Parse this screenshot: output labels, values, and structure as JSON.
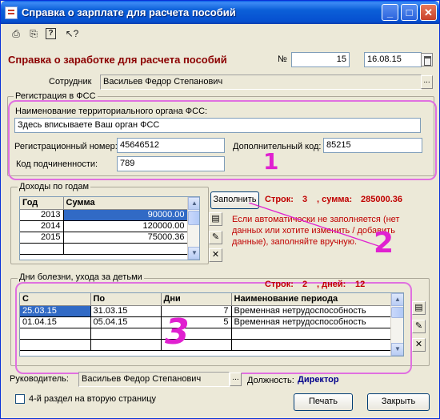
{
  "window": {
    "title": "Справка о зарплате для расчета пособий"
  },
  "toolbar": {
    "icons": [
      "print-preview-icon",
      "print-icon",
      "help-icon",
      "whats-this-icon"
    ]
  },
  "form": {
    "header": "Справка о заработке для расчета пособий",
    "number_label": "№",
    "number": "15",
    "date": "16.08.15",
    "employee_label": "Сотрудник",
    "employee": "Васильев Федор Степанович"
  },
  "fss": {
    "group_title": "Регистрация в ФСС",
    "org_label": "Наименование территориального органа ФСС:",
    "org_value": "Здесь вписываете Ваш орган ФСС",
    "reg_label": "Регистрационный номер:",
    "reg_value": "45646512",
    "add_label": "Дополнительный код:",
    "add_value": "85215",
    "sub_label": "Код подчиненности:",
    "sub_value": "789",
    "annotation": "1"
  },
  "income": {
    "group_title": "Доходы по годам",
    "columns": [
      "Год",
      "Сумма"
    ],
    "rows": [
      {
        "year": "2013",
        "sum": "90000.00"
      },
      {
        "year": "2014",
        "sum": "120000.00"
      },
      {
        "year": "2015",
        "sum": "75000.36"
      }
    ],
    "fill_button": "Заполнить",
    "rows_label": "Строк:",
    "rows_count": "3",
    "sum_label": ", сумма:",
    "sum_value": "285000.36",
    "hint": "Если автоматически не заполняется (нет данных или хотите изменить / добавить данные), заполняйте вручную.",
    "annotation": "2"
  },
  "sick": {
    "group_title": "Дни болезни, ухода за детьми",
    "rows_label": "Строк:",
    "rows_count": "2",
    "days_label": ", дней:",
    "days_value": "12",
    "columns": [
      "С",
      "По",
      "Дни",
      "Наименование периода"
    ],
    "rows": [
      {
        "from": "25.03.15",
        "to": "31.03.15",
        "days": "7",
        "name": "Временная нетрудоспособность"
      },
      {
        "from": "01.04.15",
        "to": "05.04.15",
        "days": "5",
        "name": "Временная нетрудоспособность"
      }
    ],
    "annotation": "3"
  },
  "footer": {
    "head_label": "Руководитель:",
    "head_value": "Васильев Федор Степанович",
    "position_label": "Должность:",
    "position_value": "Директор",
    "checkbox_label": "4-й раздел на вторую страницу",
    "print_button": "Печать",
    "close_button": "Закрыть"
  },
  "colors": {
    "accent": "#8b0000",
    "annotation": "#e020d0",
    "selection": "#316ac5"
  }
}
